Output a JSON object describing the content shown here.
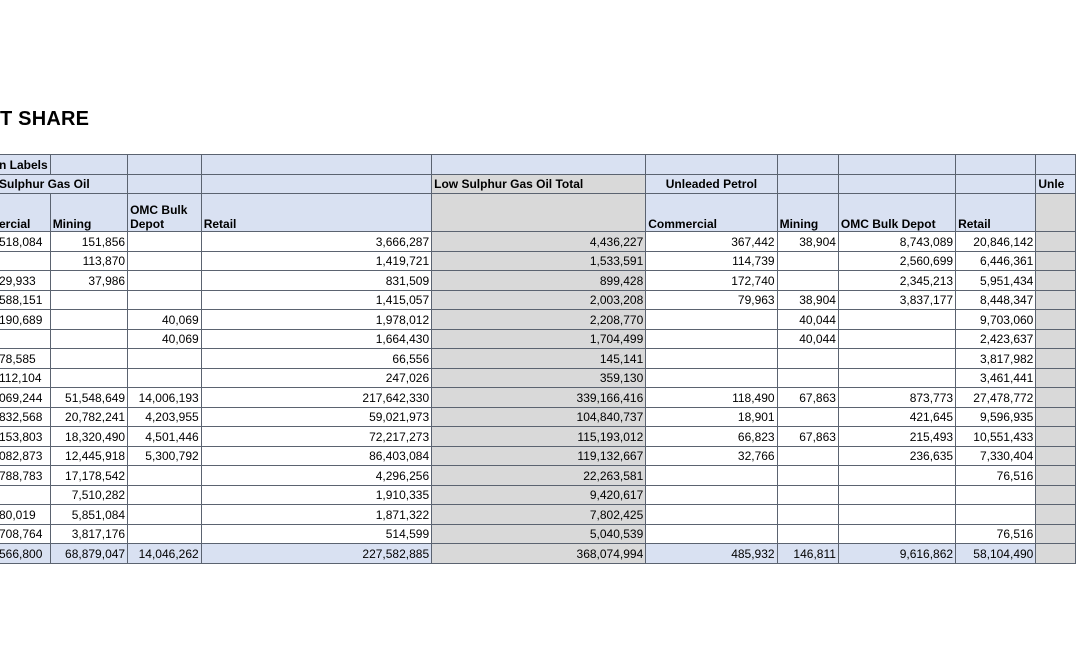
{
  "title": "T SHARE",
  "header": {
    "row1_label": "n Labels",
    "lsgo_group": "Sulphur Gas Oil",
    "lsgo_total": "Low Sulphur Gas Oil Total",
    "ulp_group": "Unleaded Petrol",
    "ule_group": "Unle",
    "columns": [
      "ercial",
      "Mining",
      "OMC Bulk Depot",
      "Retail",
      "",
      "Commercial",
      "Mining",
      "OMC Bulk Depot",
      "Retail",
      ""
    ]
  },
  "rows": [
    [
      "518,084",
      "151,856",
      "",
      "3,666,287",
      "4,436,227",
      "367,442",
      "38,904",
      "8,743,089",
      "20,846,142"
    ],
    [
      "",
      "113,870",
      "",
      "1,419,721",
      "1,533,591",
      "114,739",
      "",
      "2,560,699",
      "6,446,361"
    ],
    [
      "29,933",
      "37,986",
      "",
      "831,509",
      "899,428",
      "172,740",
      "",
      "2,345,213",
      "5,951,434"
    ],
    [
      "588,151",
      "",
      "",
      "1,415,057",
      "2,003,208",
      "79,963",
      "38,904",
      "3,837,177",
      "8,448,347"
    ],
    [
      "190,689",
      "",
      "40,069",
      "1,978,012",
      "2,208,770",
      "",
      "40,044",
      "",
      "9,703,060"
    ],
    [
      "",
      "",
      "40,069",
      "1,664,430",
      "1,704,499",
      "",
      "40,044",
      "",
      "2,423,637"
    ],
    [
      "78,585",
      "",
      "",
      "66,556",
      "145,141",
      "",
      "",
      "",
      "3,817,982"
    ],
    [
      "112,104",
      "",
      "",
      "247,026",
      "359,130",
      "",
      "",
      "",
      "3,461,441"
    ],
    [
      "069,244",
      "51,548,649",
      "14,006,193",
      "217,642,330",
      "339,166,416",
      "118,490",
      "67,863",
      "873,773",
      "27,478,772"
    ],
    [
      "832,568",
      "20,782,241",
      "4,203,955",
      "59,021,973",
      "104,840,737",
      "18,901",
      "",
      "421,645",
      "9,596,935"
    ],
    [
      "153,803",
      "18,320,490",
      "4,501,446",
      "72,217,273",
      "115,193,012",
      "66,823",
      "67,863",
      "215,493",
      "10,551,433"
    ],
    [
      "082,873",
      "12,445,918",
      "5,300,792",
      "86,403,084",
      "119,132,667",
      "32,766",
      "",
      "236,635",
      "7,330,404"
    ],
    [
      "788,783",
      "17,178,542",
      "",
      "4,296,256",
      "22,263,581",
      "",
      "",
      "",
      "76,516"
    ],
    [
      "",
      "7,510,282",
      "",
      "1,910,335",
      "9,420,617",
      "",
      "",
      "",
      ""
    ],
    [
      "80,019",
      "5,851,084",
      "",
      "1,871,322",
      "7,802,425",
      "",
      "",
      "",
      ""
    ],
    [
      "708,764",
      "3,817,176",
      "",
      "514,599",
      "5,040,539",
      "",
      "",
      "",
      "76,516"
    ]
  ],
  "grand_total": [
    "566,800",
    "68,879,047",
    "14,046,262",
    "227,582,885",
    "368,074,994",
    "485,932",
    "146,811",
    "9,616,862",
    "58,104,490"
  ]
}
